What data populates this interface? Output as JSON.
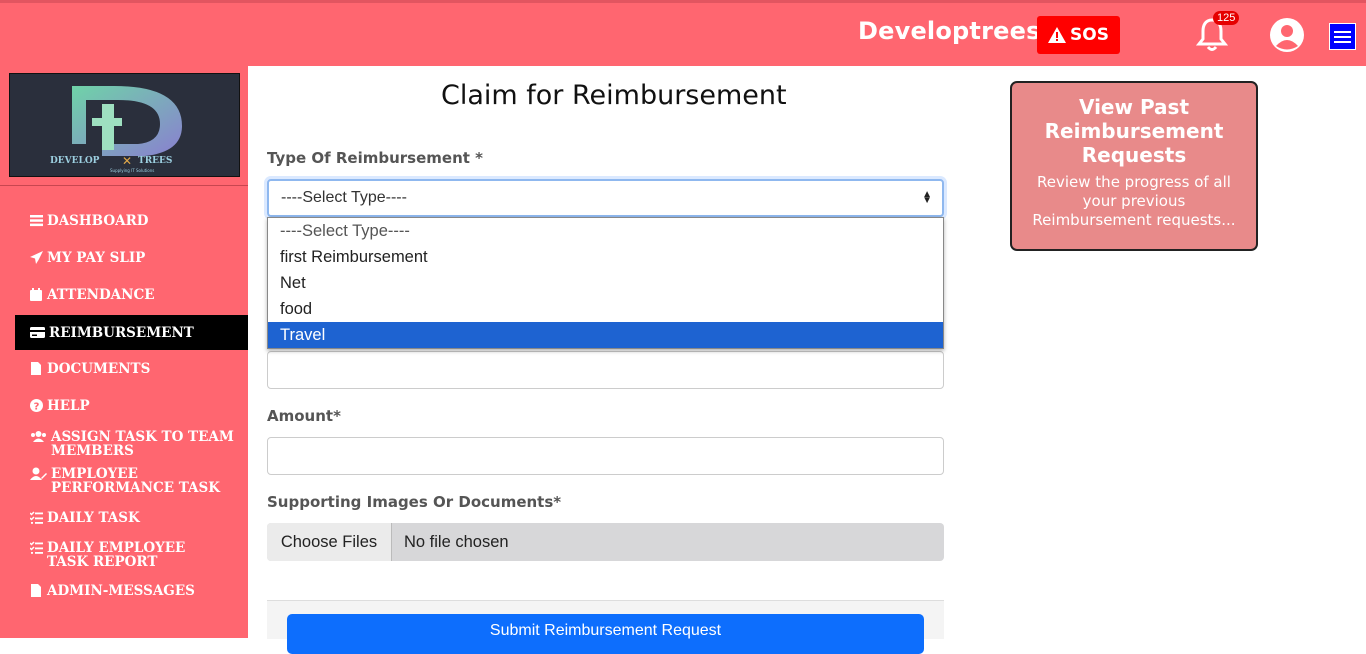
{
  "header": {
    "brand": "Developtrees",
    "sos_label": "SOS",
    "notification_count": "125"
  },
  "sidebar": {
    "logo_text": "DEVELOP TREES",
    "items": [
      {
        "label": "DASHBOARD",
        "icon": "bars-icon"
      },
      {
        "label": "MY PAY SLIP",
        "icon": "paper-plane-icon"
      },
      {
        "label": "ATTENDANCE",
        "icon": "calendar-icon"
      },
      {
        "label": "REIMBURSEMENT",
        "icon": "credit-card-icon",
        "active": true
      },
      {
        "label": "DOCUMENTS",
        "icon": "file-icon"
      },
      {
        "label": "HELP",
        "icon": "question-circle-icon"
      },
      {
        "label": "ASSIGN TASK TO TEAM MEMBERS",
        "icon": "users-icon"
      },
      {
        "label": "EMPLOYEE PERFORMANCE TASK",
        "icon": "user-edit-icon"
      },
      {
        "label": "DAILY TASK",
        "icon": "list-check-icon"
      },
      {
        "label": "DAILY EMPLOYEE TASK REPORT",
        "icon": "list-check-icon"
      },
      {
        "label": "ADMIN-MESSAGES",
        "icon": "file-icon"
      }
    ]
  },
  "form": {
    "title": "Claim for Reimbursement",
    "type_label": "Type Of Reimbursement *",
    "type_selected": "----Select Type----",
    "type_options": [
      "----Select Type----",
      "first Reimbursement",
      "Net",
      "food",
      "Travel"
    ],
    "type_highlighted": "Travel",
    "amount_label": "Amount*",
    "docs_label": "Supporting Images Or Documents*",
    "choose_files": "Choose Files",
    "no_file": "No file chosen",
    "submit_label": "Submit Reimbursement Request"
  },
  "past_card": {
    "title": "View Past Reimbursement Requests",
    "description": "Review the progress of all your previous Reimbursement requests..."
  },
  "colors": {
    "primary": "#ff6670",
    "sos": "#ff0000",
    "submit": "#0d6efd",
    "highlight": "#1e63d1",
    "card": "#e88a8a"
  }
}
